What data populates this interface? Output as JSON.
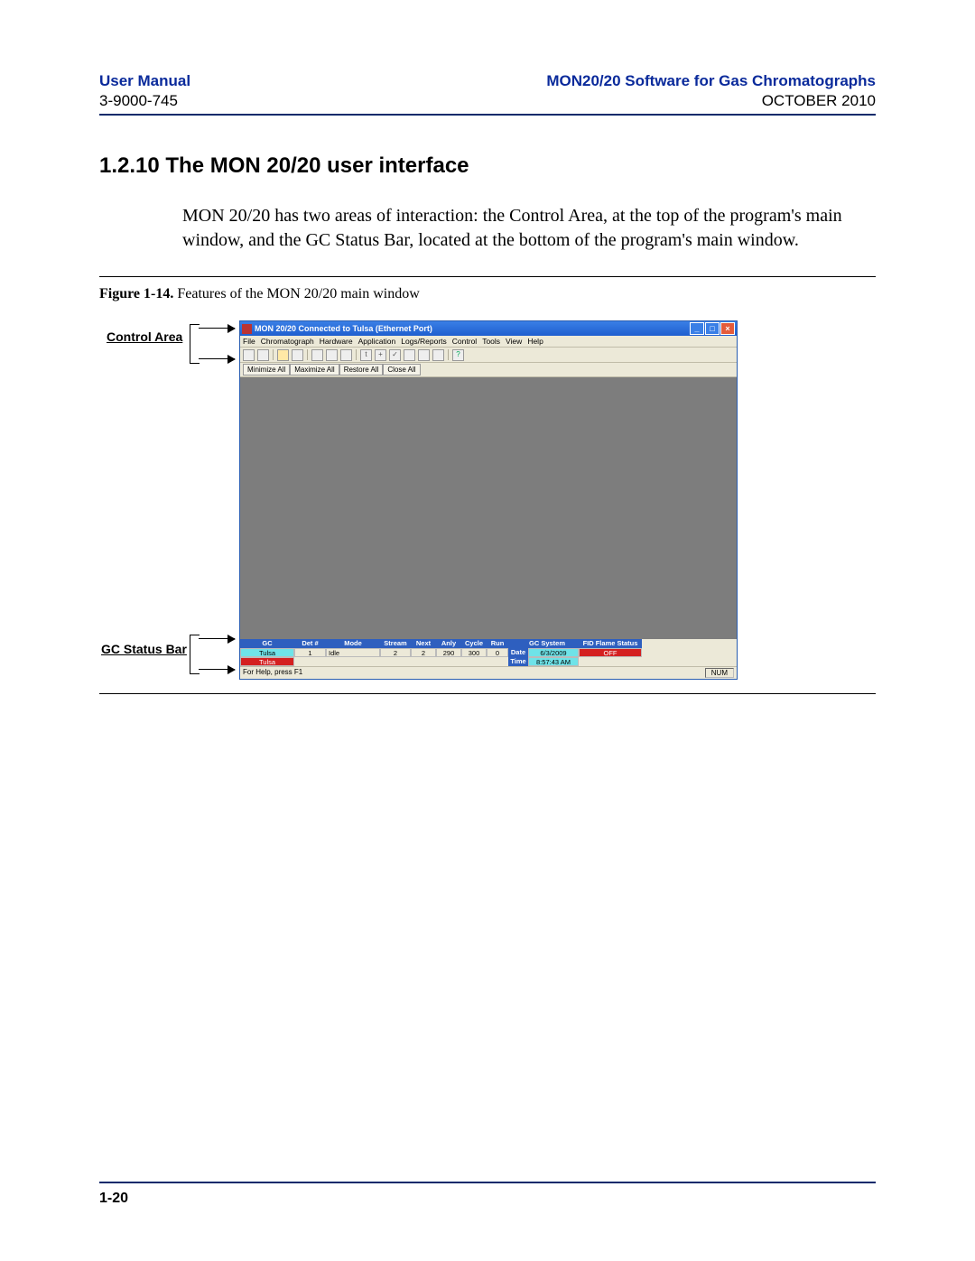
{
  "header": {
    "left_title": "User Manual",
    "left_sub": "3-9000-745",
    "right_title": "MON20/20 Software for Gas Chromatographs",
    "right_sub": "OCTOBER 2010"
  },
  "section": {
    "heading": "1.2.10 The MON 20/20 user interface",
    "body": "MON 20/20 has two areas of interaction: the Control Area, at the top of the program's main window, and the GC Status Bar, located at the bottom of the program's main window."
  },
  "figure": {
    "label": "Figure 1-14.",
    "caption": "Features of the MON 20/20 main window",
    "callout_top": "Control Area",
    "callout_bottom": "GC Status Bar"
  },
  "app": {
    "title": "MON 20/20   Connected to Tulsa (Ethernet Port)",
    "menus": [
      "File",
      "Chromatograph",
      "Hardware",
      "Application",
      "Logs/Reports",
      "Control",
      "Tools",
      "View",
      "Help"
    ],
    "window_buttons": [
      "Minimize All",
      "Maximize All",
      "Restore All",
      "Close All"
    ],
    "status_headers": [
      "GC",
      "Det #",
      "Mode",
      "Stream",
      "Next",
      "Anly",
      "Cycle",
      "Run",
      "",
      "GC System",
      "FID Flame Status"
    ],
    "status_row": {
      "gc": "Tulsa",
      "det": "1",
      "mode": "Idle",
      "stream": "2",
      "next": "2",
      "anly": "290",
      "cycle": "300",
      "run": "0",
      "date_label": "Date",
      "date_val": "6/3/2009",
      "gcsys": "",
      "fid": "OFF",
      "time_label": "Time",
      "time_val": "8:57:43 AM",
      "gc2": "Tulsa"
    },
    "helpbar_left": "For Help, press F1",
    "helpbar_right": "NUM"
  },
  "footer": {
    "page": "1-20"
  }
}
